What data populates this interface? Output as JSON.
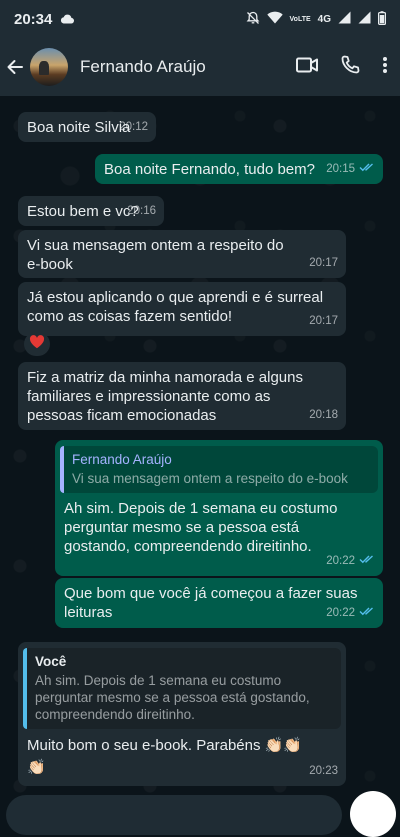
{
  "status_bar": {
    "time": "20:34",
    "network": "4G",
    "volte": "VoLTE"
  },
  "header": {
    "contact_name": "Fernando Araújo"
  },
  "messages": [
    {
      "dir": "in",
      "text": "Boa noite Silvia",
      "time": "20:12"
    },
    {
      "dir": "out",
      "text": "Boa noite Fernando, tudo bem?",
      "time": "20:15",
      "status": "read"
    },
    {
      "dir": "in",
      "text": "Estou bem e vc?",
      "time": "20:16"
    },
    {
      "dir": "in",
      "text": "Vi sua mensagem ontem a respeito do\ne-book",
      "time": "20:17"
    },
    {
      "dir": "in",
      "text": "Já estou aplicando o que aprendi e é surreal\ncomo as coisas fazem sentido!",
      "time": "20:17",
      "reaction": "❤️"
    },
    {
      "dir": "in",
      "text": "Fiz a matriz da minha namorada e alguns\nfamiliares e impressionante como as\npessoas ficam emocionadas",
      "time": "20:18"
    },
    {
      "dir": "out",
      "quote_name": "Fernando Araújo",
      "quote_text": "Vi sua mensagem ontem a respeito do e-book",
      "text": "Ah sim. Depois de 1 semana eu costumo\nperguntar mesmo se a pessoa está\ngostando, compreendendo direitinho.",
      "time": "20:22",
      "status": "read"
    },
    {
      "dir": "out",
      "text": "Que bom que você já começou a fazer suas\nleituras",
      "time": "20:22",
      "status": "read"
    },
    {
      "dir": "in",
      "quote_name": "Você",
      "quote_text": "Ah sim. Depois de 1 semana eu costumo\nperguntar mesmo se a pessoa está gostando,\ncompreendendo direitinho.",
      "text": "Muito bom o seu e-book. Parabéns 👏🏻👏🏻\n👏🏻",
      "time": "20:23"
    }
  ],
  "colors": {
    "background": "#0b141a",
    "header": "#1f2c34",
    "bubble_in": "#202c33",
    "bubble_out": "#005c4b",
    "read_ticks": "#53bdeb"
  },
  "icons": {
    "back": "arrow-left-icon",
    "video": "video-camera-icon",
    "call": "phone-icon",
    "menu": "more-vertical-icon"
  }
}
